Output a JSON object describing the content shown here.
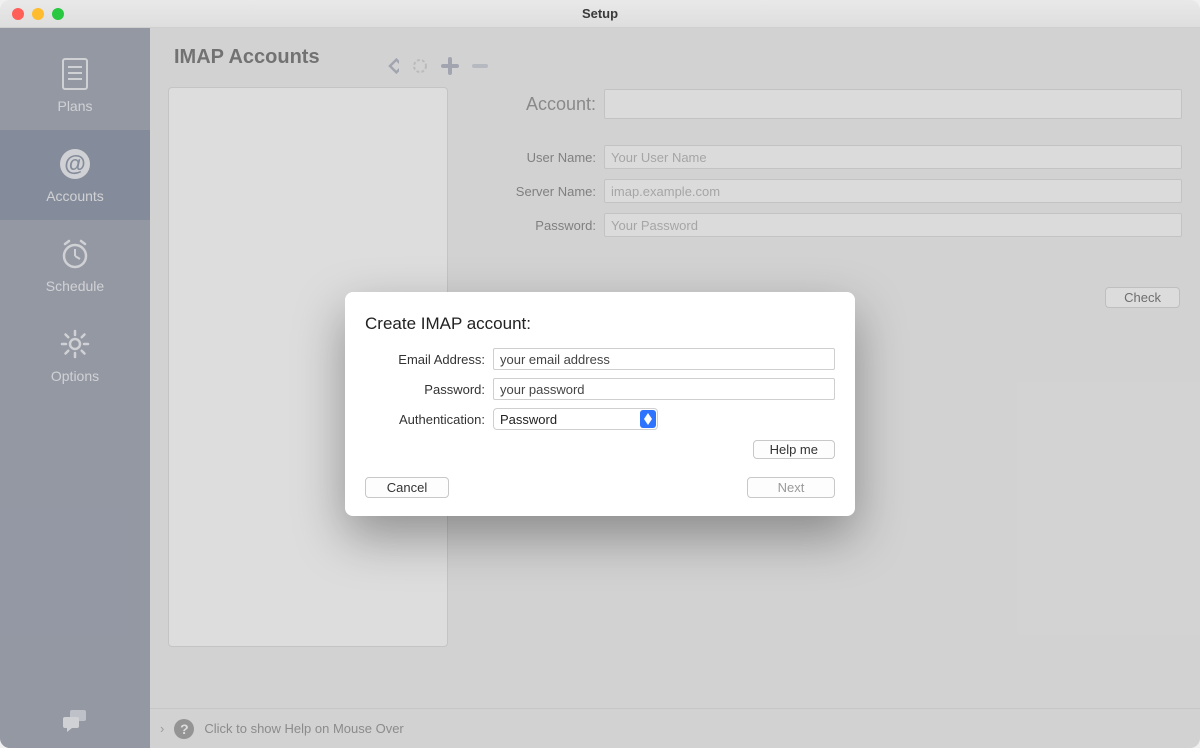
{
  "window": {
    "title": "Setup"
  },
  "sidebar": {
    "items": [
      {
        "id": "plans",
        "label": "Plans",
        "icon": "document-icon",
        "selected": false
      },
      {
        "id": "accounts",
        "label": "Accounts",
        "icon": "at-icon",
        "selected": true
      },
      {
        "id": "schedule",
        "label": "Schedule",
        "icon": "alarm-icon",
        "selected": false
      },
      {
        "id": "options",
        "label": "Options",
        "icon": "gear-icon",
        "selected": false
      }
    ],
    "chat_icon": "chat-bubbles-icon"
  },
  "page": {
    "title": "IMAP Accounts"
  },
  "toolbar": {
    "sync_icon": "sync-icon",
    "spinner_icon": "spinner-icon",
    "add_icon": "plus-icon",
    "remove_icon": "minus-icon"
  },
  "form": {
    "account_label": "Account:",
    "account_value": "",
    "user_label": "User Name:",
    "user_placeholder": "Your User Name",
    "server_label": "Server Name:",
    "server_placeholder": "imap.example.com",
    "password_label": "Password:",
    "password_placeholder": "Your Password",
    "auth_label": "Authentication:",
    "check_label": "Check"
  },
  "helpbar": {
    "text": "Click to show Help on Mouse Over",
    "question": "?"
  },
  "sheet": {
    "title": "Create IMAP account:",
    "email_label": "Email Address:",
    "email_value": "your email address",
    "password_label": "Password:",
    "password_value": "your password",
    "auth_label": "Authentication:",
    "auth_value": "Password",
    "help_label": "Help me",
    "cancel_label": "Cancel",
    "next_label": "Next"
  }
}
